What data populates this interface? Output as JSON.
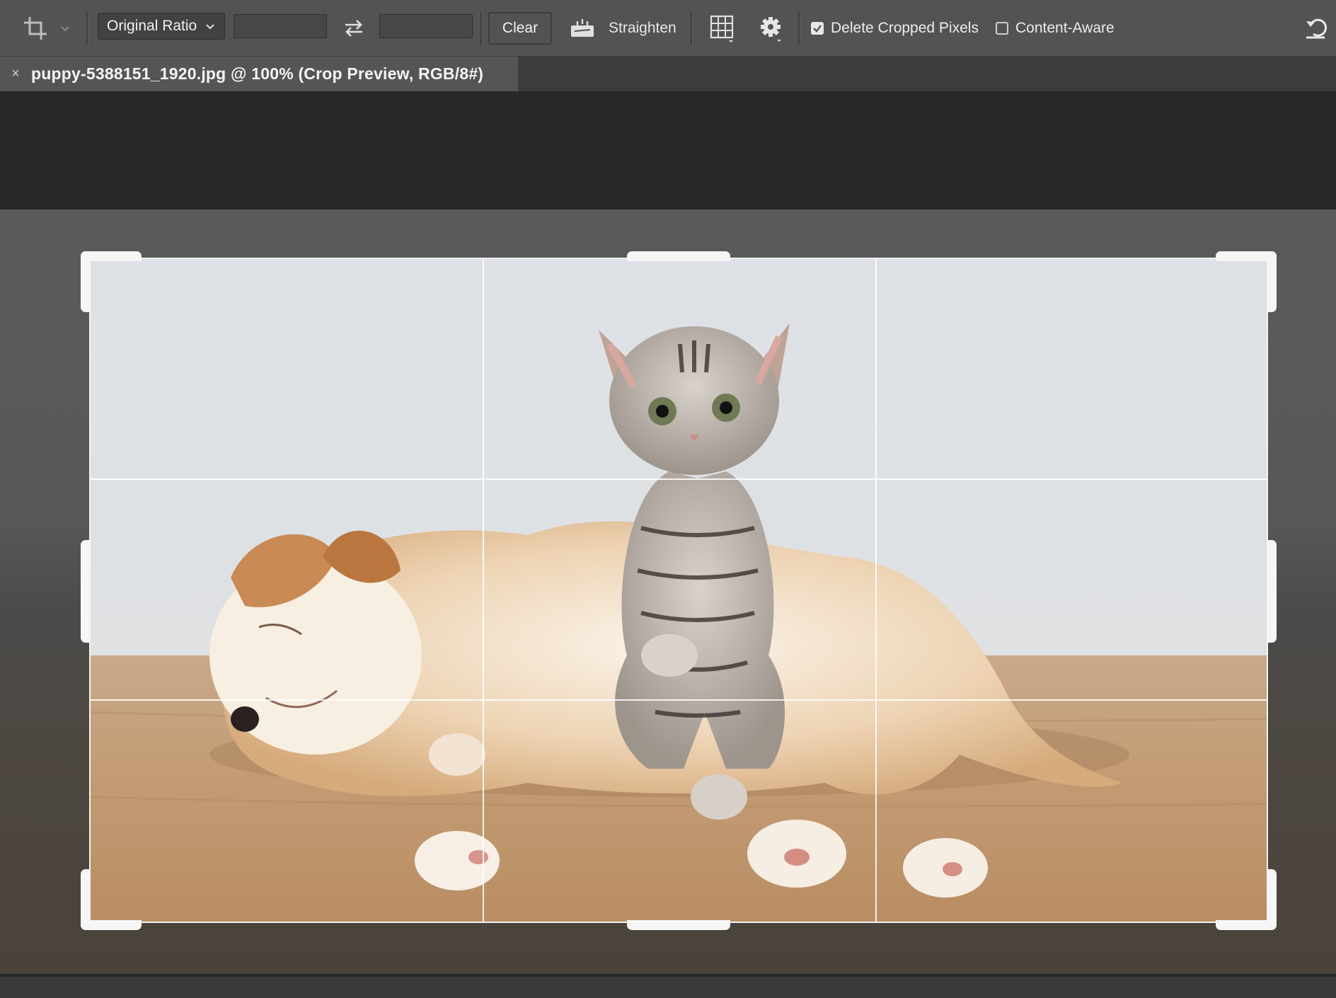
{
  "options_bar": {
    "ratio_label": "Original Ratio",
    "width_value": "",
    "height_value": "",
    "clear_label": "Clear",
    "straighten_label": "Straighten",
    "delete_cropped_label": "Delete Cropped Pixels",
    "delete_cropped_checked": true,
    "content_aware_label": "Content-Aware",
    "content_aware_checked": false
  },
  "tab": {
    "title": "puppy-5388151_1920.jpg @ 100% (Crop Preview, RGB/8#)",
    "close_glyph": "×"
  },
  "icons": [
    "crop-tool-icon",
    "chevron-down-icon",
    "swap-arrows-icon",
    "straighten-icon",
    "grid-overlay-icon",
    "gear-icon",
    "reset-icon",
    "checkbox-checked-icon",
    "checkbox-empty-icon",
    "close-icon"
  ],
  "colors": {
    "options_bar": "#535353",
    "tab_active": "#555555",
    "workspace": "#282828",
    "crop_handles": "#f6f6f6"
  }
}
